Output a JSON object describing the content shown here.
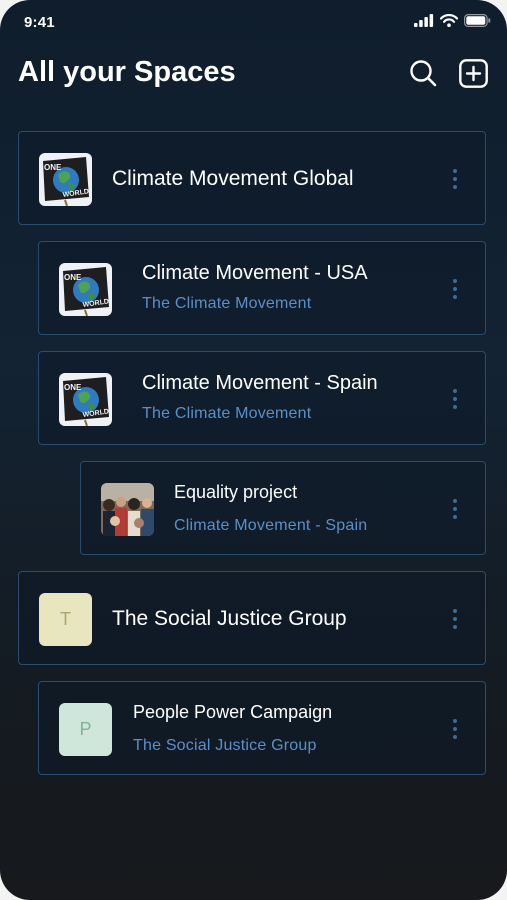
{
  "status_bar": {
    "time": "9:41"
  },
  "header": {
    "title": "All your Spaces"
  },
  "spaces": [
    {
      "name": "Climate Movement Global",
      "parent": "",
      "thumb": "one-world-image"
    },
    {
      "name": "Climate Movement - USA",
      "parent": "The Climate Movement",
      "thumb": "one-world-image"
    },
    {
      "name": "Climate Movement - Spain",
      "parent": "The Climate Movement",
      "thumb": "one-world-image"
    },
    {
      "name": "Equality project",
      "parent": "Climate Movement - Spain",
      "thumb": "crowd-photo"
    },
    {
      "name": "The Social Justice Group",
      "parent": "",
      "thumb": "letter",
      "letter": "T",
      "thumb_color": "#e7e6bf",
      "letter_color": "#a9a86e"
    },
    {
      "name": "People Power Campaign",
      "parent": "The Social Justice Group",
      "thumb": "letter",
      "letter": "P",
      "thumb_color": "#cfe7da",
      "letter_color": "#7fb49b"
    }
  ],
  "thumb_text": {
    "one": "ONE",
    "world": "WORLD"
  },
  "colors": {
    "card_border": "#2a4c6e",
    "subtitle": "#5a90c8",
    "kebab": "#3e6a96"
  }
}
